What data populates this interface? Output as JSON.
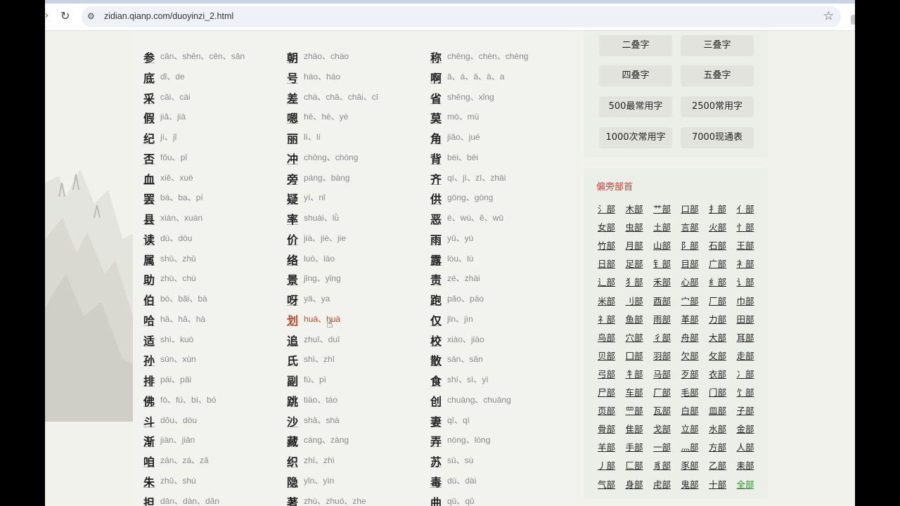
{
  "browser": {
    "url": "zidian.qianp.com/duoyinzi_2.html",
    "nav_forward_icon": "chevron-right",
    "reload_icon": "reload-icon",
    "site_settings_icon": "tune-icon",
    "bookmark_icon": "star-icon"
  },
  "colors": {
    "highlight": "#c04a2a",
    "accent_red": "#c0453a",
    "green": "#2e9a2e"
  },
  "columns": [
    [
      {
        "char": "参",
        "pinyin": "cān、shēn、cēn、sān"
      },
      {
        "char": "底",
        "pinyin": "dǐ、de"
      },
      {
        "char": "采",
        "pinyin": "cǎi、cài"
      },
      {
        "char": "假",
        "pinyin": "jiǎ、jià"
      },
      {
        "char": "纪",
        "pinyin": "jì、jǐ"
      },
      {
        "char": "否",
        "pinyin": "fǒu、pǐ"
      },
      {
        "char": "血",
        "pinyin": "xiě、xuè"
      },
      {
        "char": "罢",
        "pinyin": "bà、ba、pí"
      },
      {
        "char": "县",
        "pinyin": "xiàn、xuán"
      },
      {
        "char": "读",
        "pinyin": "dú、dòu"
      },
      {
        "char": "属",
        "pinyin": "shǔ、zhǔ"
      },
      {
        "char": "助",
        "pinyin": "zhù、chú"
      },
      {
        "char": "伯",
        "pinyin": "bó、bǎi、bà"
      },
      {
        "char": "哈",
        "pinyin": "hā、hǎ、hà"
      },
      {
        "char": "适",
        "pinyin": "shì、kuò"
      },
      {
        "char": "孙",
        "pinyin": "sūn、xùn"
      },
      {
        "char": "排",
        "pinyin": "pái、pǎi"
      },
      {
        "char": "佛",
        "pinyin": "fó、fú、bì、bó"
      },
      {
        "char": "斗",
        "pinyin": "dǒu、dòu"
      },
      {
        "char": "渐",
        "pinyin": "jiàn、jiān"
      },
      {
        "char": "咱",
        "pinyin": "zán、zá、zǎ"
      },
      {
        "char": "朱",
        "pinyin": "zhū、shú"
      },
      {
        "char": "担",
        "pinyin": "dān、dàn、dǎn"
      }
    ],
    [
      {
        "char": "朝",
        "pinyin": "zhāo、cháo"
      },
      {
        "char": "号",
        "pinyin": "hào、háo"
      },
      {
        "char": "差",
        "pinyin": "chà、chā、chāi、cī"
      },
      {
        "char": "嗯",
        "pinyin": "hē、hè、yè"
      },
      {
        "char": "丽",
        "pinyin": "lì、lí"
      },
      {
        "char": "冲",
        "pinyin": "chōng、chòng"
      },
      {
        "char": "旁",
        "pinyin": "páng、bàng"
      },
      {
        "char": "疑",
        "pinyin": "yí、nǐ"
      },
      {
        "char": "率",
        "pinyin": "shuài、lǜ"
      },
      {
        "char": "价",
        "pinyin": "jià、jiè、jie"
      },
      {
        "char": "络",
        "pinyin": "luò、lào"
      },
      {
        "char": "景",
        "pinyin": "jǐng、yǐng"
      },
      {
        "char": "呀",
        "pinyin": "yā、ya"
      },
      {
        "char": "划",
        "pinyin": "huá、huà",
        "hl": true
      },
      {
        "char": "追",
        "pinyin": "zhuī、duī"
      },
      {
        "char": "氏",
        "pinyin": "shì、zhī"
      },
      {
        "char": "副",
        "pinyin": "fù、pì"
      },
      {
        "char": "跳",
        "pinyin": "tiào、táo"
      },
      {
        "char": "沙",
        "pinyin": "shā、shà"
      },
      {
        "char": "藏",
        "pinyin": "cáng、zàng"
      },
      {
        "char": "织",
        "pinyin": "zhī、zhì"
      },
      {
        "char": "隐",
        "pinyin": "yǐn、yìn"
      },
      {
        "char": "著",
        "pinyin": "zhù、zhuó、zhe"
      }
    ],
    [
      {
        "char": "称",
        "pinyin": "chēng、chèn、chèng"
      },
      {
        "char": "啊",
        "pinyin": "ā、á、ǎ、à、a"
      },
      {
        "char": "省",
        "pinyin": "shěng、xǐng"
      },
      {
        "char": "莫",
        "pinyin": "mò、mù"
      },
      {
        "char": "角",
        "pinyin": "jiǎo、jué"
      },
      {
        "char": "背",
        "pinyin": "bèi、bēi"
      },
      {
        "char": "齐",
        "pinyin": "qí、jì、zī、zhāi"
      },
      {
        "char": "供",
        "pinyin": "gōng、gòng"
      },
      {
        "char": "恶",
        "pinyin": "è、wù、ě、wū"
      },
      {
        "char": "雨",
        "pinyin": "yǔ、yù"
      },
      {
        "char": "露",
        "pinyin": "lòu、lù"
      },
      {
        "char": "责",
        "pinyin": "zé、zhài"
      },
      {
        "char": "跑",
        "pinyin": "pǎo、páo"
      },
      {
        "char": "仅",
        "pinyin": "jǐn、jìn"
      },
      {
        "char": "校",
        "pinyin": "xiào、jiào"
      },
      {
        "char": "散",
        "pinyin": "sàn、sǎn"
      },
      {
        "char": "食",
        "pinyin": "shí、sì、yì"
      },
      {
        "char": "创",
        "pinyin": "chuàng、chuāng"
      },
      {
        "char": "妻",
        "pinyin": "qī、qì"
      },
      {
        "char": "弄",
        "pinyin": "nòng、lòng"
      },
      {
        "char": "苏",
        "pinyin": "sū、sù"
      },
      {
        "char": "毒",
        "pinyin": "dú、dài"
      },
      {
        "char": "曲",
        "pinyin": "qū、qǔ"
      }
    ]
  ],
  "sidebar": {
    "quick_links": [
      "二叠字",
      "三叠字",
      "四叠字",
      "五叠字",
      "500最常用字",
      "2500常用字",
      "1000次常用字",
      "7000现通表"
    ],
    "radicals_title": "偏旁部首",
    "radicals": [
      "氵部",
      "木部",
      "艹部",
      "口部",
      "扌部",
      "亻部",
      "女部",
      "虫部",
      "土部",
      "言部",
      "火部",
      "忄部",
      "竹部",
      "月部",
      "山部",
      "阝部",
      "石部",
      "王部",
      "日部",
      "足部",
      "钅部",
      "目部",
      "广部",
      "衤部",
      "辶部",
      "犭部",
      "禾部",
      "心部",
      "纟部",
      "讠部",
      "米部",
      "刂部",
      "酉部",
      "宀部",
      "厂部",
      "巾部",
      "礻部",
      "鱼部",
      "雨部",
      "革部",
      "力部",
      "田部",
      "鸟部",
      "穴部",
      "彳部",
      "舟部",
      "大部",
      "耳部",
      "贝部",
      "囗部",
      "羽部",
      "欠部",
      "攵部",
      "走部",
      "弓部",
      "牜部",
      "马部",
      "歹部",
      "衣部",
      "冫部",
      "尸部",
      "车部",
      "厂部",
      "毛部",
      "门部",
      "饣部",
      "页部",
      "罒部",
      "瓦部",
      "白部",
      "皿部",
      "子部",
      "骨部",
      "隹部",
      "戈部",
      "立部",
      "水部",
      "金部",
      "羊部",
      "手部",
      "一部",
      "灬部",
      "方部",
      "人部",
      "丿部",
      "匚部",
      "豸部",
      "豕部",
      "乙部",
      "耒部",
      "气部",
      "身部",
      "虍部",
      "鬼部",
      "十部",
      "全部"
    ]
  }
}
